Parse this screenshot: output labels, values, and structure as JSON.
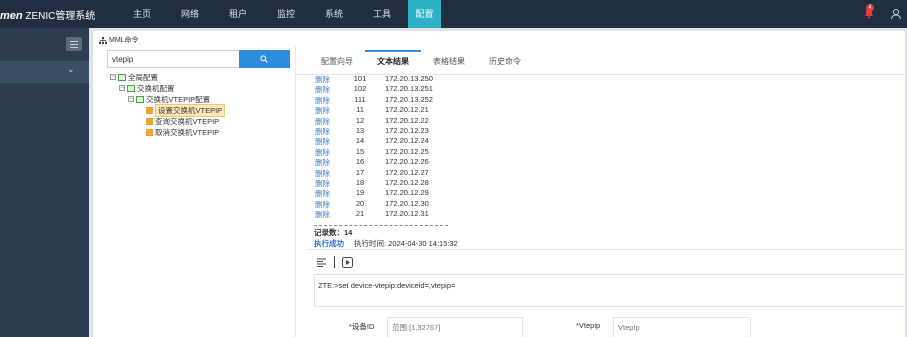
{
  "app": {
    "brand": "men",
    "title": "ZENIC管理系统"
  },
  "nav": [
    "主页",
    "网络",
    "租户",
    "监控",
    "系统",
    "工具",
    "配置"
  ],
  "nav_active_index": 6,
  "notifications": {
    "count": "4"
  },
  "panel": {
    "title": "MML命令"
  },
  "search": {
    "value": "vtepip"
  },
  "tree": {
    "root": "全局配置",
    "level1": "交换机配置",
    "level2": "交换机VTEPIP配置",
    "leaves": [
      "设置交换机VTEPIP",
      "查询交换机VTEPIP",
      "取消交换机VTEPIP"
    ]
  },
  "tabs": [
    "配置向导",
    "文本结果",
    "表格结果",
    "历史命令"
  ],
  "tab_active_index": 1,
  "results": {
    "rows": [
      {
        "op": "删除",
        "id": "101",
        "ip": "172.20.13.250"
      },
      {
        "op": "删除",
        "id": "102",
        "ip": "172.20.13.251"
      },
      {
        "op": "删除",
        "id": "111",
        "ip": "172.20.13.252"
      },
      {
        "op": "删除",
        "id": "11",
        "ip": "172.20.12.21"
      },
      {
        "op": "删除",
        "id": "12",
        "ip": "172.20.12.22"
      },
      {
        "op": "删除",
        "id": "13",
        "ip": "172.20.12.23"
      },
      {
        "op": "删除",
        "id": "14",
        "ip": "172.20.12.24"
      },
      {
        "op": "删除",
        "id": "15",
        "ip": "172.20.12.25"
      },
      {
        "op": "删除",
        "id": "16",
        "ip": "172.20.12.26"
      },
      {
        "op": "删除",
        "id": "17",
        "ip": "172.20.12.27"
      },
      {
        "op": "删除",
        "id": "18",
        "ip": "172.20.12.28"
      },
      {
        "op": "删除",
        "id": "19",
        "ip": "172.20.12.29"
      },
      {
        "op": "删除",
        "id": "20",
        "ip": "172.20.12.30"
      },
      {
        "op": "删除",
        "id": "21",
        "ip": "172.20.12.31"
      }
    ],
    "count_label": "记录数：14",
    "status_label": "执行成功",
    "time_label": "执行时间: 2024-04-30 14:15:32"
  },
  "command": {
    "text": "ZTE:>set device-vtepip:deviceid=,vtepip="
  },
  "form": {
    "device_id": {
      "label": "*设备ID",
      "placeholder": "范围:[1,32767]"
    },
    "vtep_ip": {
      "label": "*Vtepip",
      "placeholder": "VtepIp"
    }
  }
}
